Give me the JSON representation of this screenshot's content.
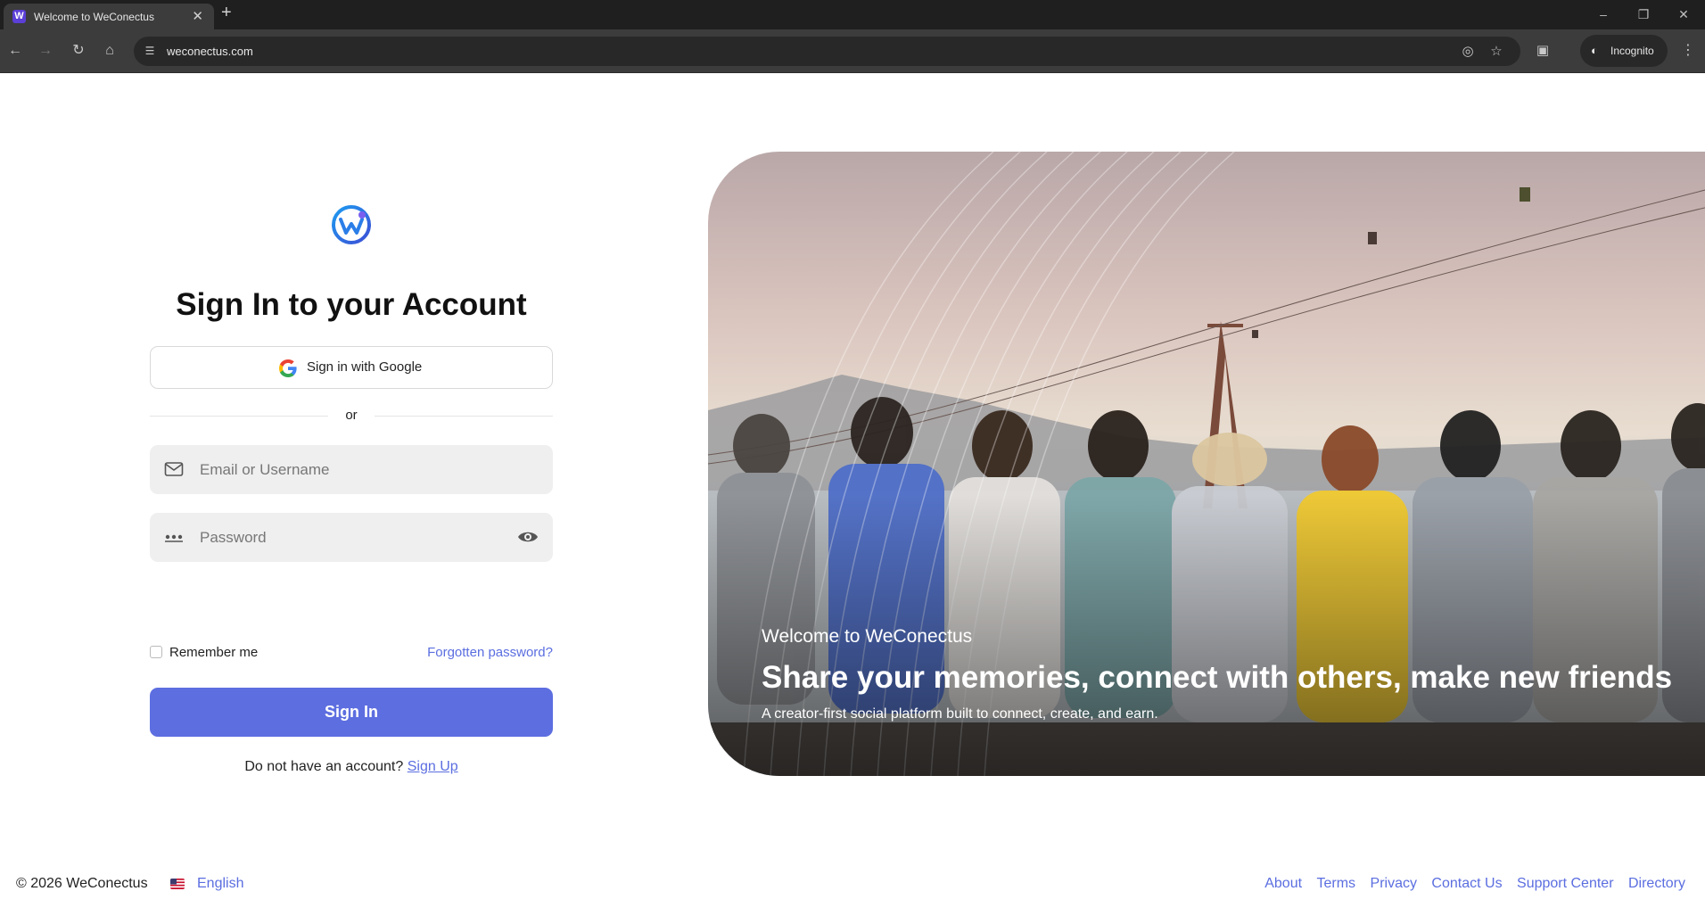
{
  "browser": {
    "tab_title": "Welcome to WeConectus",
    "favicon_letter": "W",
    "url": "weconectus.com",
    "incognito_label": "Incognito"
  },
  "signin": {
    "title": "Sign In to your Account",
    "google_label": "Sign in with Google",
    "divider_text": "or",
    "email_placeholder": "Email or Username",
    "password_placeholder": "Password",
    "remember_label": "Remember me",
    "forgot_label": "Forgotten password?",
    "submit_label": "Sign In",
    "no_account_text": "Do not have an account?",
    "signup_label": "Sign Up"
  },
  "hero": {
    "subtitle": "Welcome to WeConectus",
    "title": "Share your memories, connect with others, make new friends",
    "description": "A creator-first social platform built to connect, create, and earn."
  },
  "footer": {
    "copyright": "© 2026 WeConectus",
    "language": "English",
    "links": [
      "About",
      "Terms",
      "Privacy",
      "Contact Us",
      "Support Center",
      "Directory"
    ]
  },
  "colors": {
    "accent": "#5d6ee0",
    "link": "#5b6ee0"
  }
}
